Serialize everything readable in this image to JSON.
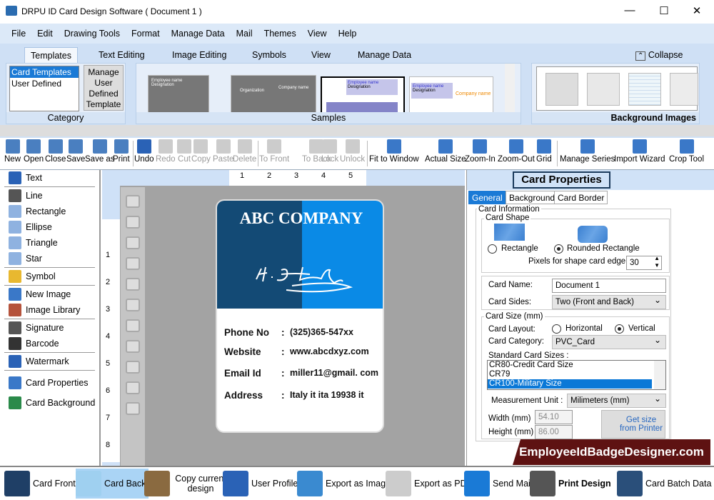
{
  "window": {
    "title": "DRPU ID Card Design Software ( Document 1 )",
    "minimize": "—",
    "maximize": "☐",
    "close": "✕"
  },
  "menu": [
    "File",
    "Edit",
    "Drawing Tools",
    "Format",
    "Manage Data",
    "Mail",
    "Themes",
    "View",
    "Help"
  ],
  "ribbon": {
    "tabs": [
      "Templates",
      "Text Editing",
      "Image Editing",
      "Symbols",
      "View",
      "Manage Data"
    ],
    "collapse": "Collapse",
    "category": {
      "label": "Category",
      "items": [
        "Card Templates",
        "User Defined"
      ],
      "manage_button": "Manage User Defined Template"
    },
    "samples": {
      "label": "Samples",
      "thumbs": [
        "Employee name",
        "Designation",
        "Organization",
        "Company name",
        "Employee name",
        "Designation",
        "Employee name",
        "Designation",
        "Company name"
      ]
    },
    "background_images": {
      "label": "Background Images"
    }
  },
  "toolbar": [
    {
      "label": "New",
      "icon": "new-file-icon",
      "enabled": true
    },
    {
      "label": "Open",
      "icon": "open-folder-icon",
      "enabled": true
    },
    {
      "label": "Close",
      "icon": "close-file-icon",
      "enabled": true
    },
    {
      "label": "Save",
      "icon": "save-icon",
      "enabled": true
    },
    {
      "label": "Save as",
      "icon": "save-as-icon",
      "enabled": true
    },
    {
      "label": "Print",
      "icon": "print-icon",
      "enabled": true
    },
    {
      "label": "Undo",
      "icon": "undo-icon",
      "enabled": true
    },
    {
      "label": "Redo",
      "icon": "redo-icon",
      "enabled": false
    },
    {
      "label": "Cut",
      "icon": "cut-icon",
      "enabled": false
    },
    {
      "label": "Copy",
      "icon": "copy-icon",
      "enabled": false
    },
    {
      "label": "Paste",
      "icon": "paste-icon",
      "enabled": false
    },
    {
      "label": "Delete",
      "icon": "delete-icon",
      "enabled": false
    },
    {
      "label": "To Front",
      "icon": "to-front-icon",
      "enabled": false
    },
    {
      "label": "To Back",
      "icon": "to-back-icon",
      "enabled": false
    },
    {
      "label": "Lock",
      "icon": "lock-icon",
      "enabled": false
    },
    {
      "label": "Unlock",
      "icon": "unlock-icon",
      "enabled": false
    },
    {
      "label": "Fit to Window",
      "icon": "fit-window-icon",
      "enabled": true
    },
    {
      "label": "Actual Size",
      "icon": "actual-size-icon",
      "enabled": true
    },
    {
      "label": "Zoom-In",
      "icon": "zoom-in-icon",
      "enabled": true
    },
    {
      "label": "Zoom-Out",
      "icon": "zoom-out-icon",
      "enabled": true
    },
    {
      "label": "Grid",
      "icon": "grid-icon",
      "enabled": true
    },
    {
      "label": "Manage Series",
      "icon": "manage-series-icon",
      "enabled": true
    },
    {
      "label": "Import Wizard",
      "icon": "import-wizard-icon",
      "enabled": true
    },
    {
      "label": "Crop Tool",
      "icon": "crop-icon",
      "enabled": true
    }
  ],
  "left_panel": [
    {
      "label": "Text",
      "icon": "text-icon"
    },
    {
      "label": "Line",
      "icon": "line-icon"
    },
    {
      "label": "Rectangle",
      "icon": "rectangle-icon"
    },
    {
      "label": "Ellipse",
      "icon": "ellipse-icon"
    },
    {
      "label": "Triangle",
      "icon": "triangle-icon"
    },
    {
      "label": "Star",
      "icon": "star-icon"
    },
    {
      "label": "Symbol",
      "icon": "symbol-icon"
    },
    {
      "label": "New Image",
      "icon": "new-image-icon"
    },
    {
      "label": "Image Library",
      "icon": "image-library-icon"
    },
    {
      "label": "Signature",
      "icon": "signature-icon"
    },
    {
      "label": "Barcode",
      "icon": "barcode-icon"
    },
    {
      "label": "Watermark",
      "icon": "watermark-icon"
    },
    {
      "label": "Card Properties",
      "icon": "card-properties-icon"
    },
    {
      "label": "Card Background",
      "icon": "card-background-icon"
    }
  ],
  "rulers": {
    "top": [
      "1",
      "2",
      "3",
      "4",
      "5"
    ],
    "left": [
      "1",
      "2",
      "3",
      "4",
      "5",
      "6",
      "7",
      "8"
    ]
  },
  "card": {
    "company": "ABC COMPANY",
    "colors": {
      "left": "#134a75",
      "right": "#0a8ae6"
    },
    "rows": [
      {
        "key": "Phone No",
        "value": "(325)365-547xx"
      },
      {
        "key": "Website",
        "value": "www.abcdxyz.com"
      },
      {
        "key": "Email Id",
        "value": "miller11@gmail. com"
      },
      {
        "key": "Address",
        "value": "Italy it ita 19938 it"
      }
    ],
    "separator": ":"
  },
  "properties": {
    "title": "Card Properties",
    "tabs": [
      "General",
      "Background",
      "Card Border"
    ],
    "card_information": "Card Information",
    "card_shape": "Card Shape",
    "rectangle": "Rectangle",
    "rounded_rectangle": "Rounded Rectangle",
    "shape_selected": "Rounded Rectangle",
    "pixels_label": "Pixels for shape card edge :",
    "pixels_value": "30",
    "card_name_label": "Card Name:",
    "card_name": "Document 1",
    "card_sides_label": "Card Sides:",
    "card_sides": "Two (Front and Back)",
    "card_size": "Card Size (mm)",
    "layout_label": "Card Layout:",
    "horizontal": "Horizontal",
    "vertical": "Vertical",
    "layout_selected": "Vertical",
    "category_label": "Card Category:",
    "category": "PVC_Card",
    "standard_label": "Standard Card Sizes :",
    "standard_sizes": [
      "CR80-Credit Card Size",
      "CR79",
      "CR100-Military Size"
    ],
    "standard_selected": "CR100-Military Size",
    "unit_label": "Measurement Unit :",
    "unit": "Milimeters (mm)",
    "width_label": "Width  (mm)",
    "width": "54.10",
    "height_label": "Height  (mm)",
    "height": "86.00",
    "get_size": "Get size from Printer"
  },
  "watermark": "EmployeeIdBadgeDesigner.com",
  "bottom": [
    {
      "label": "Card Front",
      "icon": "card-front-icon"
    },
    {
      "label": "Card Back",
      "icon": "card-back-icon",
      "active": true
    },
    {
      "label": "Copy current design",
      "icon": "copy-design-icon"
    },
    {
      "label": "User Profile",
      "icon": "user-profile-icon"
    },
    {
      "label": "Export as Image",
      "icon": "export-image-icon"
    },
    {
      "label": "Export as PDF",
      "icon": "export-pdf-icon"
    },
    {
      "label": "Send Mail",
      "icon": "send-mail-icon"
    },
    {
      "label": "Print Design",
      "icon": "print-design-icon"
    },
    {
      "label": "Card Batch Data",
      "icon": "card-batch-icon"
    }
  ]
}
